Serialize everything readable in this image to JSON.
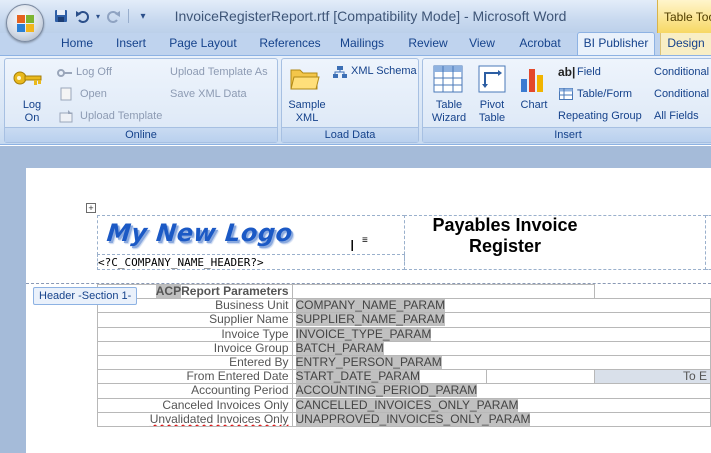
{
  "window": {
    "title": "InvoiceRegisterReport.rtf [Compatibility Mode] - Microsoft Word",
    "context_tab": "Table Too"
  },
  "tabs": [
    "Home",
    "Insert",
    "Page Layout",
    "References",
    "Mailings",
    "Review",
    "View",
    "Acrobat",
    "BI Publisher",
    "Design"
  ],
  "active_tab": "BI Publisher",
  "ribbon": {
    "online": {
      "label": "Online",
      "log_on": "Log\nOn",
      "log_off": "Log Off",
      "open": "Open",
      "upload_template": "Upload Template",
      "upload_template_as": "Upload Template As",
      "save_xml_data": "Save XML Data"
    },
    "load_data": {
      "label": "Load Data",
      "sample_xml": "Sample\nXML",
      "xml_schema": "XML Schema"
    },
    "insert": {
      "label": "Insert",
      "table_wizard": "Table\nWizard",
      "pivot_table": "Pivot\nTable",
      "chart": "Chart",
      "field": "Field",
      "table_form": "Table/Form",
      "repeating_group": "Repeating Group",
      "conditional_1": "Conditional",
      "conditional_2": "Conditional",
      "all_fields": "All Fields"
    }
  },
  "document": {
    "logo_text": "My New Logo",
    "company_field": "<?C_COMPANY_NAME_HEADER?>",
    "report_title": "Payables Invoice Register",
    "section_tag": "Header -Section 1-",
    "params_header_prefix": "ACP",
    "params_header": "Report Parameters",
    "params": [
      {
        "label": "Business Unit",
        "value": "COMPANY_NAME_PARAM"
      },
      {
        "label": "Supplier Name",
        "value": "SUPPLIER_NAME_PARAM"
      },
      {
        "label": "Invoice Type",
        "value": "INVOICE_TYPE_PARAM"
      },
      {
        "label": "Invoice Group",
        "value": "BATCH_PARAM"
      },
      {
        "label": "Entered By",
        "value": "ENTRY_PERSON_PARAM"
      },
      {
        "label": "From Entered Date",
        "value": "START_DATE_PARAM",
        "extra": "To E"
      },
      {
        "label": "Accounting Period",
        "value": "ACCOUNTING_PERIOD_PARAM"
      },
      {
        "label": "Canceled Invoices Only",
        "value": "CANCELLED_INVOICES_ONLY_PARAM"
      },
      {
        "label": "Unvalidated Invoices Only",
        "value": "UNAPPROVED_INVOICES_ONLY_PARAM"
      }
    ]
  },
  "colors": {
    "ribbon_text": "#15428b",
    "title_bar": "#c8d9ef",
    "doc_background": "#a5bbd9",
    "logo_blue": "#1b59c5"
  },
  "icons": [
    "office-button-icon",
    "save-icon",
    "undo-icon",
    "redo-icon",
    "customize-qat-icon",
    "key-icon",
    "log-off-icon",
    "open-icon",
    "upload-icon",
    "upload-as-icon",
    "save-xml-icon",
    "folder-icon",
    "xml-schema-icon",
    "table-wizard-icon",
    "pivot-table-icon",
    "chart-icon",
    "field-icon",
    "table-form-icon",
    "table-move-handle-icon",
    "text-cursor-icon",
    "paragraph-mark-icon"
  ]
}
